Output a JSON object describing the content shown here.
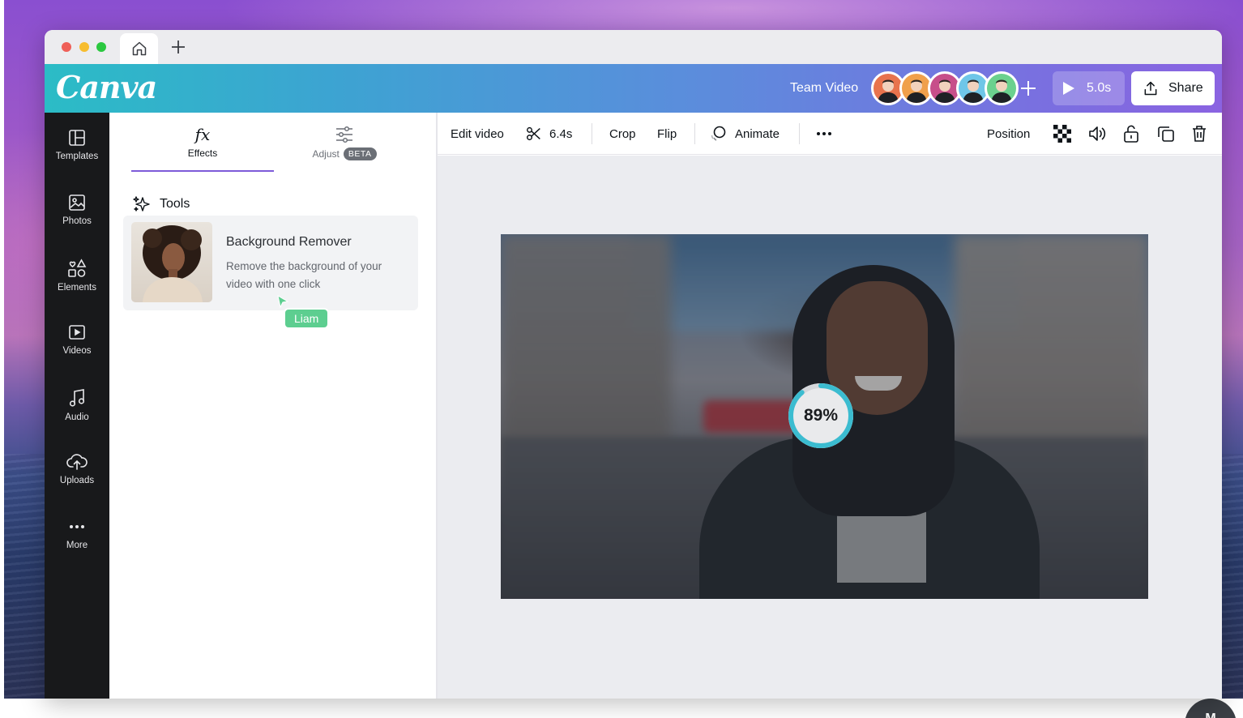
{
  "browser": {
    "home_tab": "home-icon",
    "new_tab": "plus-icon"
  },
  "header": {
    "logo": "Canva",
    "design_title": "Team Video",
    "collaborators": [
      {
        "name": "collaborator-1",
        "color": "#e8734d"
      },
      {
        "name": "collaborator-2",
        "color": "#f0a04b"
      },
      {
        "name": "collaborator-3",
        "color": "#c74e8a"
      },
      {
        "name": "collaborator-4",
        "color": "#6fc6e8"
      },
      {
        "name": "collaborator-5",
        "color": "#6bd18e"
      }
    ],
    "play_label": "5.0s",
    "share_label": "Share"
  },
  "leftnav": {
    "items": [
      {
        "label": "Templates",
        "icon": "templates-icon"
      },
      {
        "label": "Photos",
        "icon": "photos-icon"
      },
      {
        "label": "Elements",
        "icon": "elements-icon"
      },
      {
        "label": "Videos",
        "icon": "videos-icon"
      },
      {
        "label": "Audio",
        "icon": "audio-icon"
      },
      {
        "label": "Uploads",
        "icon": "uploads-icon"
      },
      {
        "label": "More",
        "icon": "more-icon"
      }
    ]
  },
  "panel": {
    "tabs": [
      {
        "label": "Effects",
        "icon": "fx"
      },
      {
        "label": "Adjust",
        "badge": "BETA"
      }
    ],
    "tools_heading": "Tools",
    "tool": {
      "title": "Background Remover",
      "description": "Remove the background of your video with one click"
    },
    "cursor_user": "Liam"
  },
  "toolbar": {
    "edit_video": "Edit video",
    "duration": "6.4s",
    "crop": "Crop",
    "flip": "Flip",
    "animate": "Animate",
    "position": "Position"
  },
  "canvas": {
    "progress_label": "89%",
    "progress_value": 0.89
  },
  "colors": {
    "accent": "#7d5bd9",
    "nav_bg": "#18191b",
    "cursor_tag": "#5dce90"
  }
}
